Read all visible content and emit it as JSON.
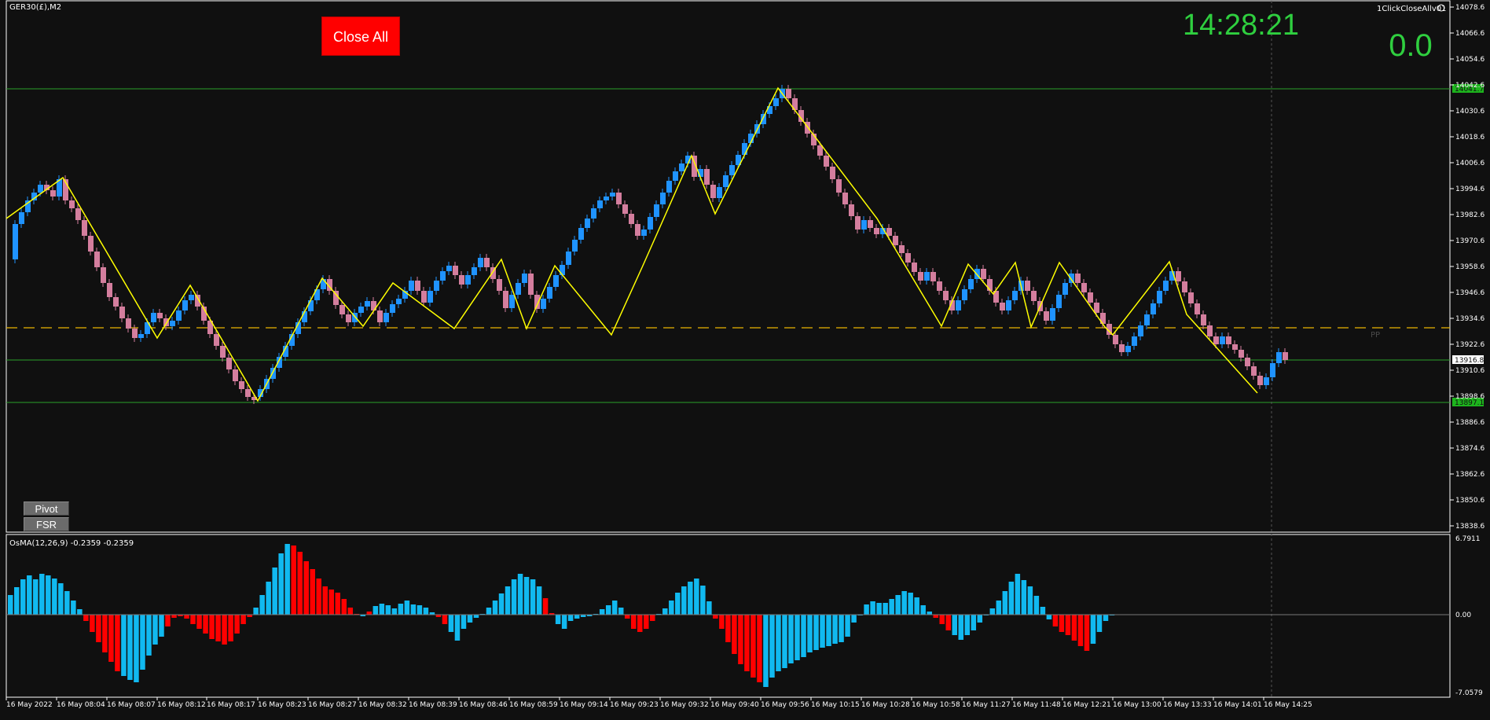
{
  "window": {
    "symbol": "GER30(£),M2",
    "expert_label": "1ClickCloseAllv01"
  },
  "controls": {
    "close_all_label": "Close All",
    "clock": "14:28:21",
    "profit": "0.0",
    "pivot_label": "Pivot",
    "fsr_label": "FSR",
    "pp_label": "PP"
  },
  "colors": {
    "background": "#101010",
    "bull": "#1f93ff",
    "bear": "#d47e9e",
    "zigzag": "#ffff00",
    "pivot": "#e9b400",
    "support_resistance": "#2aa12a",
    "osma_up": "#11b9f0",
    "osma_down": "#ff0000"
  },
  "main_chart": {
    "ylabels": [
      "14078.6",
      "14066.6",
      "14054.6",
      "14042.6",
      "14030.6",
      "14018.6",
      "14006.6",
      "13994.6",
      "13982.6",
      "13970.6",
      "13958.6",
      "13946.6",
      "13934.6",
      "13922.6",
      "13910.6",
      "13898.6",
      "13886.6",
      "13874.6",
      "13862.6",
      "13850.6",
      "13838.6"
    ],
    "xlabels": [
      "16 May 2022",
      "16 May 08:04",
      "16 May 08:07",
      "16 May 08:12",
      "16 May 08:17",
      "16 May 08:23",
      "16 May 08:27",
      "16 May 08:32",
      "16 May 08:39",
      "16 May 08:46",
      "16 May 08:59",
      "16 May 09:14",
      "16 May 09:23",
      "16 May 09:32",
      "16 May 09:40",
      "16 May 09:56",
      "16 May 10:15",
      "16 May 10:28",
      "16 May 10:58",
      "16 May 11:27",
      "16 May 11:48",
      "16 May 12:21",
      "16 May 13:00",
      "16 May 13:33",
      "16 May 14:01",
      "16 May 14:25"
    ],
    "price_tags": {
      "resistance": "14041.7",
      "current": "13916.8",
      "support": "13897.1"
    }
  },
  "osma": {
    "title": "OsMA(12,26,9) -0.2359 -0.2359",
    "ylabels": [
      "6.7911",
      "0.00",
      "-7.0579"
    ]
  }
}
